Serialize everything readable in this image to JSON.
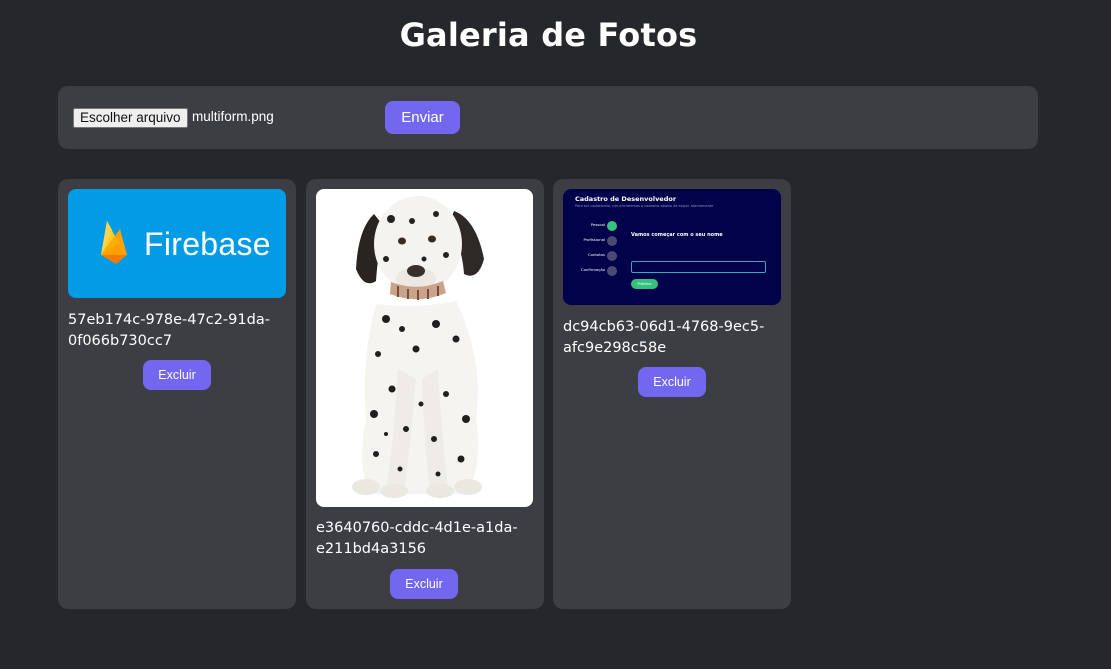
{
  "page": {
    "title": "Galeria de Fotos"
  },
  "upload": {
    "choose_file_label": "Escolher arquivo",
    "file_name": "multiform.png",
    "send_label": "Enviar"
  },
  "photos": [
    {
      "id": "57eb174c-978e-47c2-91da-0f066b730cc7",
      "delete_label": "Excluir",
      "image": {
        "logo_text": "Firebase"
      }
    },
    {
      "id": "e3640760-cddc-4d1e-a1da-e211bd4a3156",
      "delete_label": "Excluir",
      "image": {}
    },
    {
      "id": "dc94cb63-06d1-4768-9ec5-afc9e298c58e",
      "delete_label": "Excluir",
      "image": {
        "title": "Cadastro de Desenvolvedor",
        "subtitle": "Para ser cadastrado, nós enviaremos o cadastro abaixo de seguir atentamente",
        "steps": [
          "Pessoal",
          "Profissional",
          "Contatos",
          "Confirmação"
        ],
        "heading": "Vamos começar com o seu nome",
        "button_label": "Próximo"
      }
    }
  ],
  "colors": {
    "background": "#26262d",
    "panel": "#3d3e44",
    "accent": "#7367f0",
    "firebase_blue": "#039be5",
    "form_navy": "#02024a"
  }
}
